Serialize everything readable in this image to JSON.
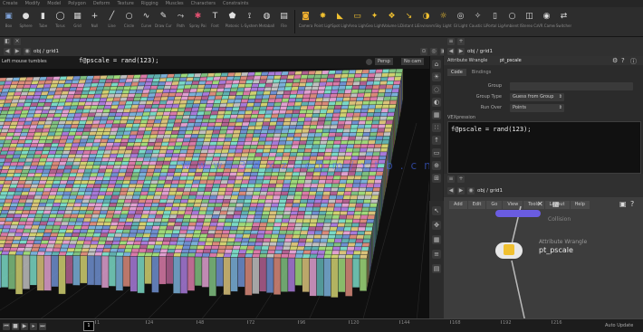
{
  "menu": {
    "shelf_tabs": [
      "Create",
      "Modify",
      "Model",
      "Polygon",
      "Deform",
      "Texture",
      "Rigging",
      "Muscles",
      "Characters",
      "Constraints"
    ],
    "tools_left": [
      {
        "label": "Box",
        "icon": "box-icon",
        "color": "#7fa3d9"
      },
      {
        "label": "Sphere",
        "icon": "sphere-icon",
        "color": "#dddddd"
      },
      {
        "label": "Tube",
        "icon": "tube-icon",
        "color": "#dddddd"
      },
      {
        "label": "Torus",
        "icon": "torus-icon",
        "color": "#dddddd"
      },
      {
        "label": "Grid",
        "icon": "grid-icon",
        "color": "#cfcfcf"
      },
      {
        "label": "Null",
        "icon": "null-icon",
        "color": "#e0e0e0"
      },
      {
        "label": "Line",
        "icon": "line-icon",
        "color": "#e0e0e0"
      },
      {
        "label": "Circle",
        "icon": "circle-icon",
        "color": "#e0e0e0"
      },
      {
        "label": "Curve",
        "icon": "curve-icon",
        "color": "#e0e0e0"
      },
      {
        "label": "Draw Curve",
        "icon": "draw-curve-icon",
        "color": "#e0e0e0"
      },
      {
        "label": "Path",
        "icon": "path-icon",
        "color": "#e0e0e0"
      },
      {
        "label": "Spray Paint",
        "icon": "spray-paint-icon",
        "color": "#e05070"
      },
      {
        "label": "Font",
        "icon": "font-icon",
        "color": "#e0e0e0"
      },
      {
        "label": "Platonic",
        "icon": "platonic-icon",
        "color": "#e0e0e0"
      },
      {
        "label": "L-System",
        "icon": "lsystem-icon",
        "color": "#e0e0e0"
      },
      {
        "label": "Metaball",
        "icon": "metaball-icon",
        "color": "#e0e0e0"
      },
      {
        "label": "File",
        "icon": "file-icon",
        "color": "#e0e0e0"
      }
    ],
    "tools_right": [
      {
        "label": "Camera",
        "icon": "camera-icon",
        "color": "#f0b030"
      },
      {
        "label": "Point Light",
        "icon": "point-light-icon",
        "color": "#f0c030"
      },
      {
        "label": "Spot Light",
        "icon": "spot-light-icon",
        "color": "#f0c030"
      },
      {
        "label": "Area Light",
        "icon": "area-light-icon",
        "color": "#f0c030"
      },
      {
        "label": "Geo Light",
        "icon": "geo-light-icon",
        "color": "#f0c030"
      },
      {
        "label": "Volume Light",
        "icon": "volume-light-icon",
        "color": "#f0c030"
      },
      {
        "label": "Distant Light",
        "icon": "distant-light-icon",
        "color": "#f0c030"
      },
      {
        "label": "Environment Light",
        "icon": "env-light-icon",
        "color": "#f0c030"
      },
      {
        "label": "Sky Light",
        "icon": "sky-light-icon",
        "color": "#f0c030"
      },
      {
        "label": "GI Light",
        "icon": "gi-light-icon",
        "color": "#dddddd"
      },
      {
        "label": "Caustic Light",
        "icon": "caustic-light-icon",
        "color": "#dddddd"
      },
      {
        "label": "Portal Light",
        "icon": "portal-light-icon",
        "color": "#dddddd"
      },
      {
        "label": "Ambient Light",
        "icon": "ambient-light-icon",
        "color": "#dddddd"
      },
      {
        "label": "Stereo Camera",
        "icon": "stereo-camera-icon",
        "color": "#dddddd"
      },
      {
        "label": "VR Camera",
        "icon": "vr-camera-icon",
        "color": "#dddddd"
      },
      {
        "label": "Switcher",
        "icon": "switcher-icon",
        "color": "#dddddd"
      }
    ]
  },
  "viewport": {
    "path": "obj  /  grid1",
    "hint": "Left mouse tumbles",
    "expression": "f@pscale = rand(123);",
    "persp_label": "Persp",
    "cam_label": "No cam",
    "watermark": "www.3dxz.com/xtb.cn"
  },
  "params": {
    "path": "obj  /  grid1",
    "node_type": "Attribute Wrangle",
    "node_name": "pt_pscale",
    "tabs": [
      "Code",
      "Bindings"
    ],
    "group_label": "Group",
    "group_type_label": "Group Type",
    "group_type_value": "Guess from Group",
    "run_over_label": "Run Over",
    "run_over_value": "Points",
    "vexpr_label": "VEXpression",
    "code": "f@pscale = rand(123);"
  },
  "network": {
    "path": "obj  /  grid1",
    "tabs": [
      "Add",
      "Edit",
      "Go",
      "View",
      "Tools",
      "Layout",
      "Help"
    ],
    "node1_label": "Collision",
    "node2_type": "Attribute Wrangle",
    "node2_name": "pt_pscale"
  },
  "timeline": {
    "frame": "1",
    "ticks": [
      "1",
      "24",
      "48",
      "72",
      "96",
      "120",
      "144",
      "168",
      "192",
      "216"
    ],
    "end_label": "240",
    "auto_update": "Auto Update"
  }
}
